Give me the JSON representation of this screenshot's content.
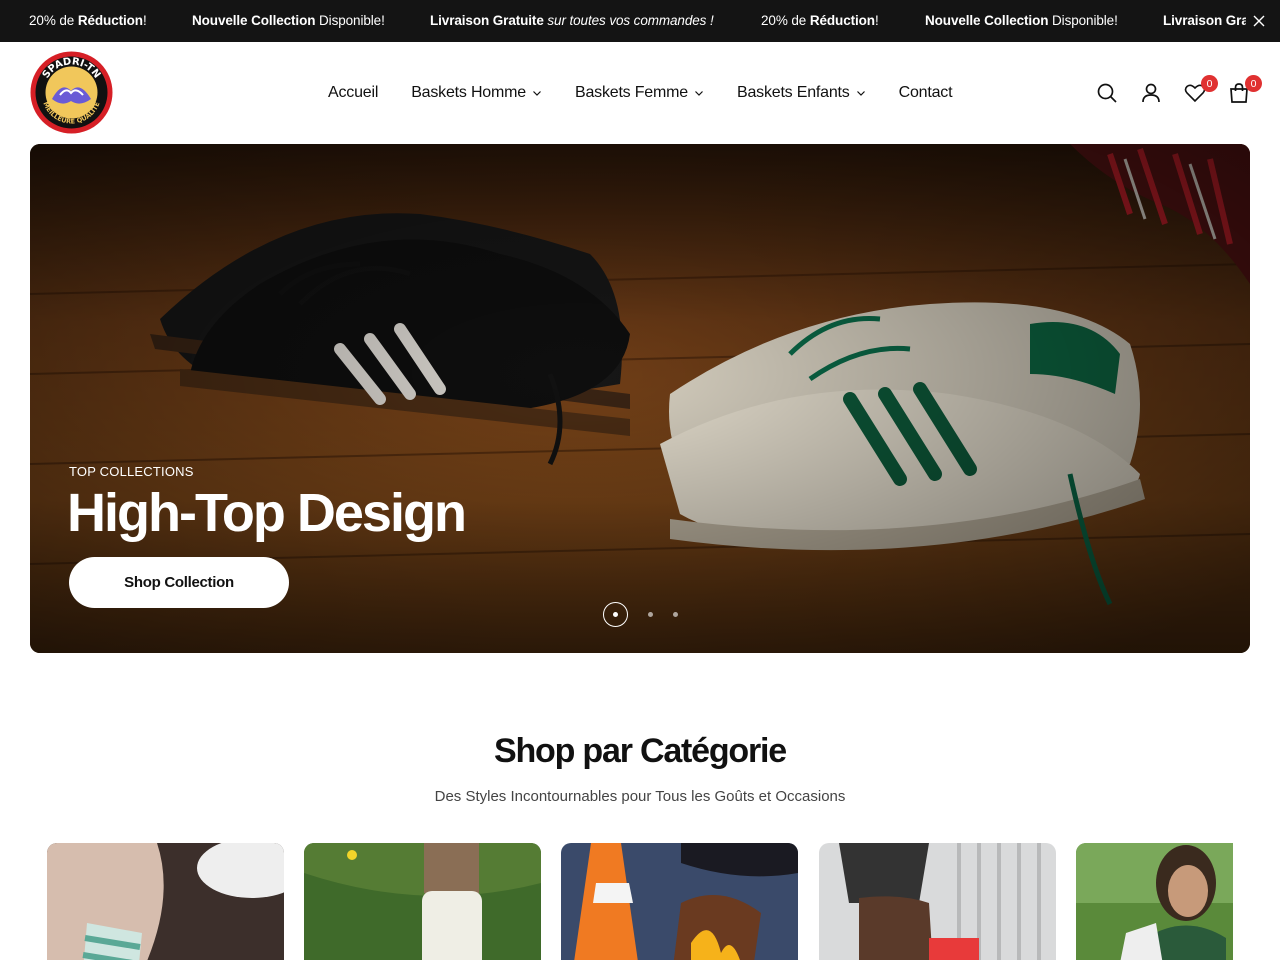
{
  "announcement": {
    "items": [
      {
        "pre": "20% de ",
        "bold": "Réduction",
        "post": "!"
      },
      {
        "bold": "Nouvelle Collection",
        "post": " Disponible!"
      },
      {
        "bold": "Livraison Gratuite",
        "italic": " sur toutes vos commandes !"
      },
      {
        "pre": "20% de ",
        "bold": "Réduction",
        "post": "!"
      },
      {
        "bold": "Nouvelle Collection",
        "post": " Disponible!"
      },
      {
        "bold": "Livraison Grat",
        "post": ""
      }
    ]
  },
  "header": {
    "logo_text": "SPADRI-TN · MEILLEURE QUALITÉ",
    "nav": [
      {
        "label": "Accueil",
        "dropdown": false
      },
      {
        "label": "Baskets Homme",
        "dropdown": true
      },
      {
        "label": "Baskets Femme",
        "dropdown": true
      },
      {
        "label": "Baskets Enfants",
        "dropdown": true
      },
      {
        "label": "Contact",
        "dropdown": false
      }
    ],
    "icons": [
      "search-icon",
      "account-icon",
      "wishlist-icon",
      "cart-icon"
    ],
    "wishlist_count": "0",
    "cart_count": "0"
  },
  "hero": {
    "kicker": "TOP COLLECTIONS",
    "title": "High-Top Design",
    "cta": "Shop Collection",
    "slides": 3,
    "active_slide": 1
  },
  "categories": {
    "title": "Shop par Catégorie",
    "subtitle": "Des Styles Incontournables pour Tous les Goûts et Occasions"
  },
  "colors": {
    "topbar": "#141414",
    "badge": "#e03131",
    "text": "#111111"
  }
}
